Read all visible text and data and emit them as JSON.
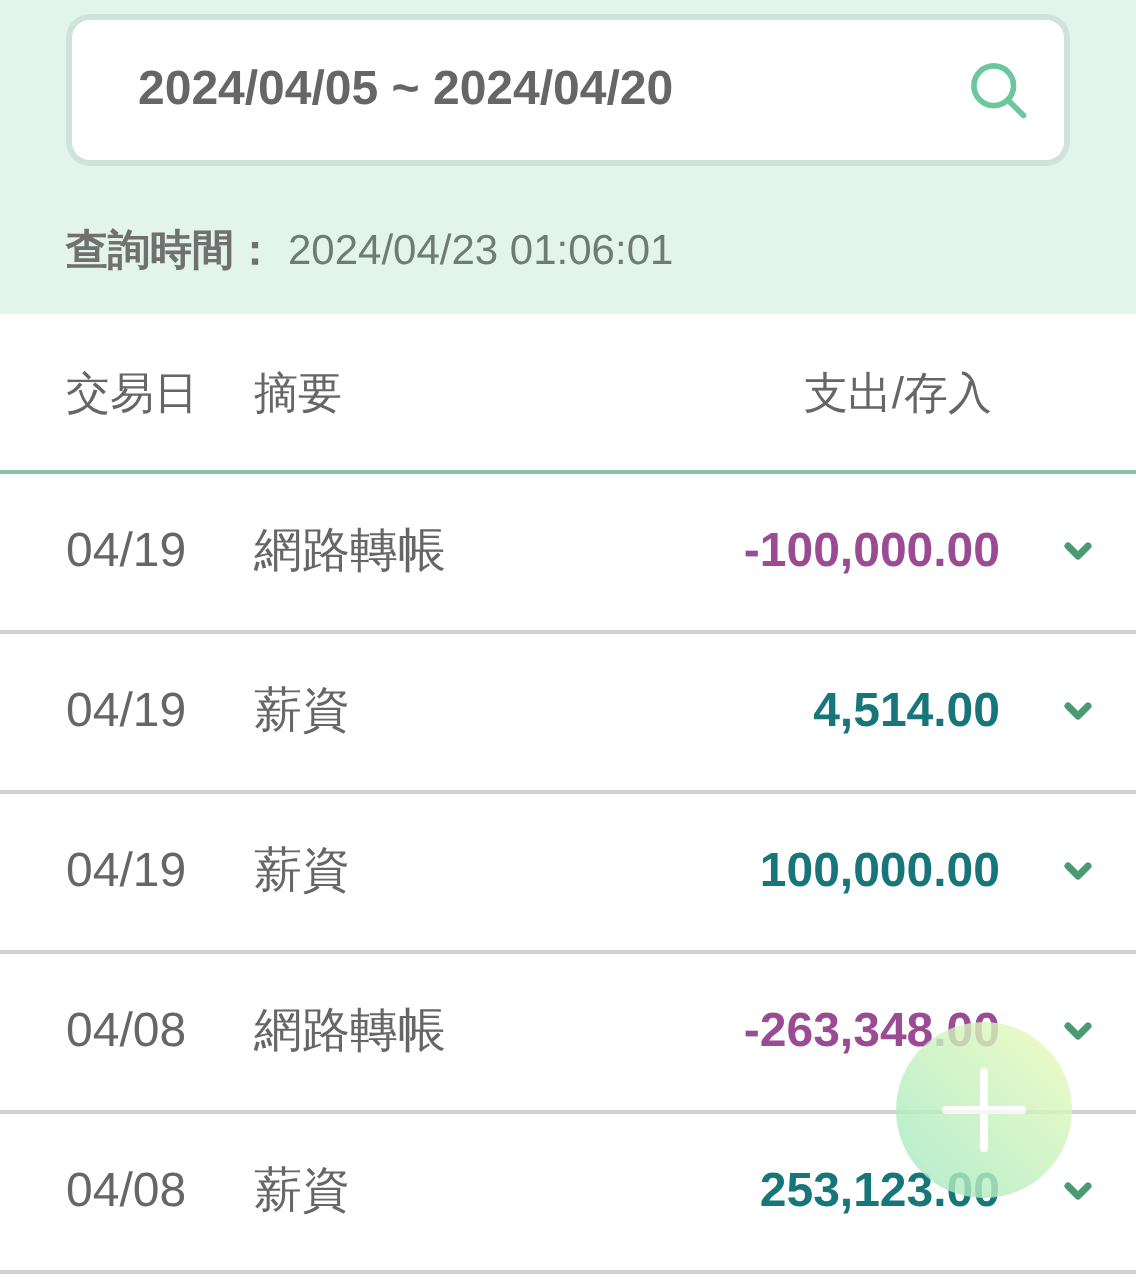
{
  "search": {
    "value": "2024/04/05 ~ 2024/04/20"
  },
  "query_time": {
    "label": "查詢時間：",
    "value": "2024/04/23 01:06:01"
  },
  "table": {
    "columns": [
      "交易日",
      "摘要",
      "支出/存入"
    ],
    "rows": [
      {
        "date": "04/19",
        "summary": "網路轉帳",
        "amount": "-100,000.00",
        "kind": "debit"
      },
      {
        "date": "04/19",
        "summary": "薪資",
        "amount": "4,514.00",
        "kind": "credit"
      },
      {
        "date": "04/19",
        "summary": "薪資",
        "amount": "100,000.00",
        "kind": "credit"
      },
      {
        "date": "04/08",
        "summary": "網路轉帳",
        "amount": "-263,348.00",
        "kind": "debit"
      },
      {
        "date": "04/08",
        "summary": "薪資",
        "amount": "253,123.00",
        "kind": "credit"
      }
    ]
  }
}
